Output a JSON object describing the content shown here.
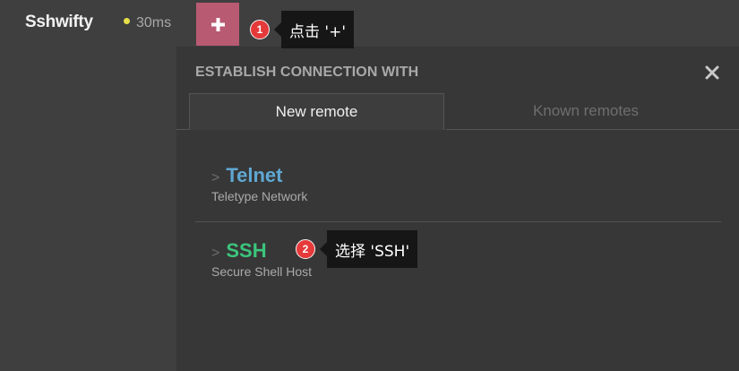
{
  "app": {
    "title": "Sshwifty",
    "latency": "30ms",
    "add_icon": "plus-icon"
  },
  "panel": {
    "title": "ESTABLISH CONNECTION WITH",
    "close_icon": "close-icon",
    "tabs": [
      {
        "label": "New remote",
        "active": true
      },
      {
        "label": "Known remotes",
        "active": false
      }
    ],
    "options": [
      {
        "chevron": ">",
        "name": "Telnet",
        "description": "Teletype Network",
        "color": "#5fa8d3"
      },
      {
        "chevron": ">",
        "name": "SSH",
        "description": "Secure Shell Host",
        "color": "#3cc57c"
      }
    ]
  },
  "annotations": [
    {
      "number": "1",
      "text": "点击 '+'"
    },
    {
      "number": "2",
      "text": "选择 'SSH'"
    }
  ],
  "colors": {
    "background": "#3f3f3f",
    "panel": "#373737",
    "add_button": "#b85a72",
    "latency_dot": "#e5e04a",
    "badge": "#e5393a"
  }
}
